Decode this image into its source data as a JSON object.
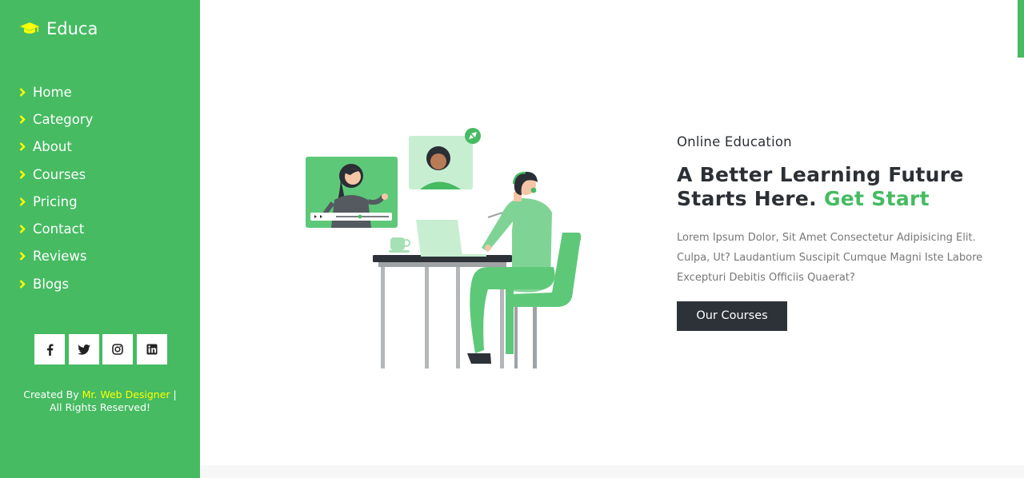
{
  "brand": {
    "name": "Educa",
    "icon": "graduation-cap-icon",
    "icon_color": "#ffff00"
  },
  "nav": {
    "items": [
      {
        "label": "Home"
      },
      {
        "label": "Category"
      },
      {
        "label": "About"
      },
      {
        "label": "Courses"
      },
      {
        "label": "Pricing"
      },
      {
        "label": "Contact"
      },
      {
        "label": "Reviews"
      },
      {
        "label": "Blogs"
      }
    ],
    "bullet_icon": "chevron-right-icon"
  },
  "socials": [
    "facebook-icon",
    "twitter-icon",
    "instagram-icon",
    "linkedin-icon"
  ],
  "footer": {
    "prefix": "Created By",
    "author": "Mr. Web Designer",
    "separator": "|",
    "rights": "All Rights Reserved!"
  },
  "hero": {
    "subtitle": "Online Education",
    "headline_line1": "A Better Learning Future",
    "headline_line2": "Starts Here.",
    "headline_accent": "Get Start",
    "description": "Lorem Ipsum Dolor, Sit Amet Consectetur Adipisicing Elit. Culpa, Ut? Laudantium Suscipit Cumque Magni Iste Labore Excepturi Debitis Officiis Quaerat?",
    "button_label": "Our Courses"
  },
  "colors": {
    "primary": "#46bb62",
    "dark": "#2c3238",
    "highlight": "#ffff00",
    "text": "#2c3035",
    "muted": "#777777"
  }
}
